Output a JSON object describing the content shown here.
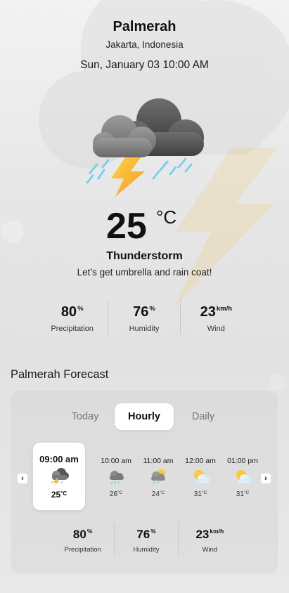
{
  "location": {
    "city": "Palmerah",
    "region": "Jakarta, Indonesia"
  },
  "datetime": "Sun, January 03 10:00 AM",
  "current": {
    "icon": "thunderstorm-icon",
    "temperature": "25",
    "unit": "°C",
    "condition": "Thunderstorm",
    "advice": "Let’s get umbrella and rain coat!"
  },
  "stats": [
    {
      "value": "80",
      "unit": "%",
      "label": "Precipitation"
    },
    {
      "value": "76",
      "unit": "%",
      "label": "Humidity"
    },
    {
      "value": "23",
      "unit": "km/h",
      "label": "Wind"
    }
  ],
  "forecast": {
    "title": "Palmerah Forecast",
    "tabs": [
      "Today",
      "Hourly",
      "Daily"
    ],
    "active_tab": "Hourly",
    "prev_arrow": "‹",
    "next_arrow": "›",
    "hours": [
      {
        "time": "09:00 am",
        "temp": "25",
        "unit": "°C",
        "icon": "thunderstorm-icon",
        "active": true
      },
      {
        "time": "10:00 am",
        "temp": "26",
        "unit": "°C",
        "icon": "rain-cloud-icon"
      },
      {
        "time": "11:00 am",
        "temp": "24",
        "unit": "°C",
        "icon": "sun-rain-icon"
      },
      {
        "time": "12:00 am",
        "temp": "31",
        "unit": "°C",
        "icon": "partly-cloudy-icon"
      },
      {
        "time": "01:00 pm",
        "temp": "31",
        "unit": "°C",
        "icon": "partly-cloudy-icon"
      }
    ],
    "stats": [
      {
        "value": "80",
        "unit": "%",
        "label": "Precipitation"
      },
      {
        "value": "76",
        "unit": "%",
        "label": "Humidity"
      },
      {
        "value": "23",
        "unit": "km/h",
        "label": "Wind"
      }
    ]
  },
  "colors": {
    "background": "#e6e6e6",
    "bolt": "#f5b82e",
    "rain": "#6ad0ef",
    "cloud_dark": "#5c5c5c",
    "sun": "#ffc83a"
  }
}
